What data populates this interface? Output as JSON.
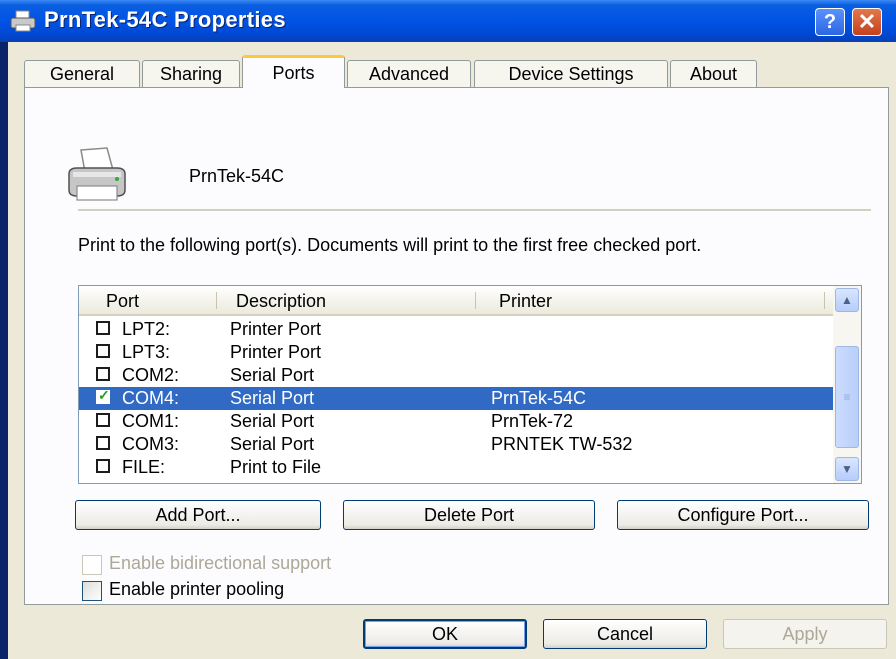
{
  "window": {
    "title": "PrnTek-54C Properties",
    "help_label": "?",
    "close_label": "✕"
  },
  "tabs": [
    {
      "label": "General"
    },
    {
      "label": "Sharing"
    },
    {
      "label": "Ports",
      "active": true
    },
    {
      "label": "Advanced"
    },
    {
      "label": "Device Settings"
    },
    {
      "label": "About"
    }
  ],
  "printer_name": "PrnTek-54C",
  "description": "Print to the following port(s). Documents will print to the first free checked port.",
  "port_list": {
    "columns": [
      "Port",
      "Description",
      "Printer"
    ],
    "rows": [
      {
        "port": "LPT2:",
        "description": "Printer Port",
        "printer": "",
        "checked": false
      },
      {
        "port": "LPT3:",
        "description": "Printer Port",
        "printer": "",
        "checked": false
      },
      {
        "port": "COM2:",
        "description": "Serial Port",
        "printer": "",
        "checked": false
      },
      {
        "port": "COM4:",
        "description": "Serial Port",
        "printer": "PrnTek-54C",
        "checked": true,
        "selected": true
      },
      {
        "port": "COM1:",
        "description": "Serial Port",
        "printer": "PrnTek-72",
        "checked": false
      },
      {
        "port": "COM3:",
        "description": "Serial Port",
        "printer": "PRNTEK TW-532",
        "checked": false
      },
      {
        "port": "FILE:",
        "description": "Print to File",
        "printer": "",
        "checked": false
      }
    ]
  },
  "port_buttons": {
    "add": "Add Port...",
    "delete": "Delete Port",
    "configure": "Configure Port..."
  },
  "options": {
    "bidirectional": {
      "label": "Enable bidirectional support",
      "checked": false,
      "enabled": false
    },
    "pooling": {
      "label": "Enable printer pooling",
      "checked": false,
      "enabled": true
    }
  },
  "dialog_buttons": {
    "ok": "OK",
    "cancel": "Cancel",
    "apply": "Apply"
  },
  "colors": {
    "titlebar": "#0053e6",
    "selection": "#316ac5",
    "face": "#ece9d8"
  }
}
